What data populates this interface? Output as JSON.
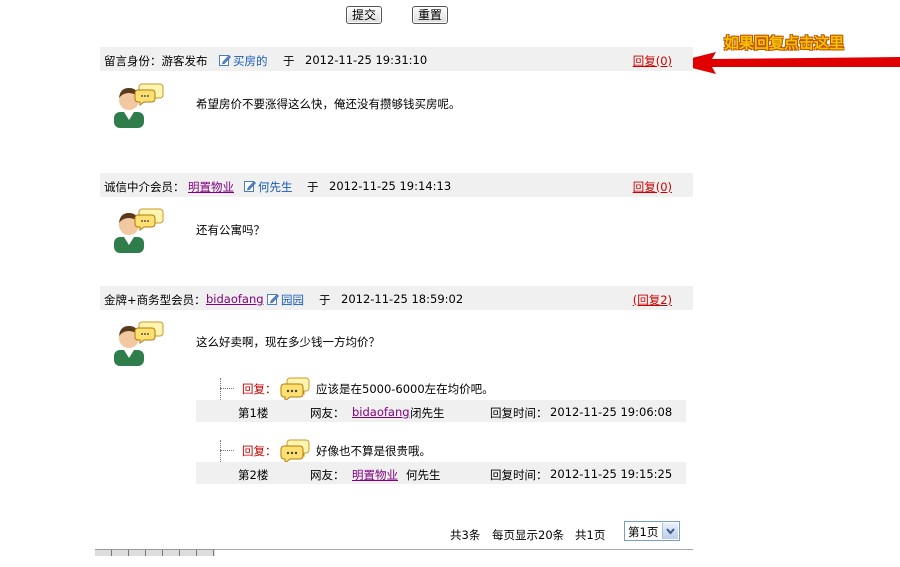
{
  "form": {
    "submit_label": "提交",
    "reset_label": "重置"
  },
  "annotation": {
    "text": "如果回复点击这里",
    "color": "#f5c400"
  },
  "common": {
    "at": "于"
  },
  "posts": [
    {
      "role": "留言身份：游客发布",
      "company": "",
      "user": "买房的",
      "time": "2012-11-25 19:31:10",
      "reply_link": "回复(0)",
      "message": "希望房价不要涨得这么快，俺还没有攒够钱买房呢。"
    },
    {
      "role": "诚信中介会员：",
      "company": "明置物业",
      "user": "何先生",
      "time": "2012-11-25 19:14:13",
      "reply_link": "回复(0)",
      "message": "还有公寓吗？"
    },
    {
      "role": "金牌+商务型会员：",
      "company": "bidaofang",
      "user": "园园",
      "time": "2012-11-25 18:59:02",
      "reply_link": "(回复2)",
      "message": "这么好卖啊，现在多少钱一方均价？",
      "replies": [
        {
          "label": "回复：",
          "text": "应该是在5000-6000左在均价吧。",
          "floor": "第1楼",
          "friend_label": "网友：",
          "friend_company": "bidaofang",
          "friend_name": "闭先生",
          "time_label": "回复时间：",
          "time": "2012-11-25 19:06:08"
        },
        {
          "label": "回复：",
          "text": "好像也不算是很贵哦。",
          "floor": "第2楼",
          "friend_label": "网友：",
          "friend_company": "明置物业",
          "friend_name": "何先生",
          "time_label": "回复时间：",
          "time": "2012-11-25 19:15:25"
        }
      ]
    }
  ],
  "pager": {
    "total": "共3条",
    "per_page": "每页显示20条",
    "pages": "共1页",
    "current_page": "第1页"
  },
  "colors": {
    "reply_red": "#cc0000",
    "link_purple": "#800080",
    "header_bg": "#f0f0f0",
    "arrow_red": "#e00000"
  }
}
